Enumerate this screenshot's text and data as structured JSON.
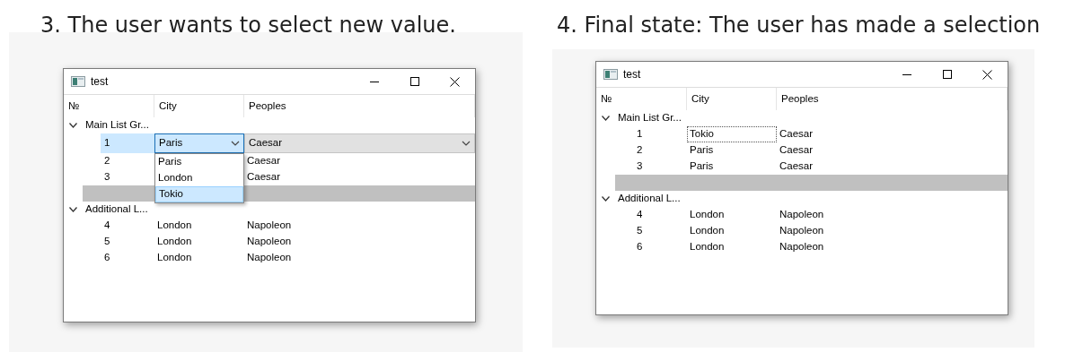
{
  "panels": [
    {
      "caption": "3. The user wants to select new value.",
      "window": {
        "title": "test",
        "columns": [
          "№",
          "City",
          "Peoples"
        ],
        "groups": [
          {
            "name": "Main List Gr...",
            "expanded": true,
            "blank_row": true,
            "rows": [
              {
                "number": "1",
                "city": "Paris",
                "people": "Caesar",
                "editing": true,
                "focused": false,
                "dropdown": [
                  {
                    "label": "Paris",
                    "selected": false
                  },
                  {
                    "label": "London",
                    "selected": false
                  },
                  {
                    "label": "Tokio",
                    "selected": true
                  }
                ]
              },
              {
                "number": "2",
                "people": "Caesar",
                "editing": false,
                "focused": false
              },
              {
                "number": "3",
                "people": "Caesar",
                "editing": false,
                "focused": false
              }
            ]
          },
          {
            "name": "Additional L...",
            "expanded": true,
            "blank_row": false,
            "rows": [
              {
                "number": "4",
                "city": "London",
                "people": "Napoleon",
                "editing": false,
                "focused": false
              },
              {
                "number": "5",
                "city": "London",
                "people": "Napoleon",
                "editing": false,
                "focused": false
              },
              {
                "number": "6",
                "city": "London",
                "people": "Napoleon",
                "editing": false,
                "focused": false
              }
            ]
          }
        ]
      }
    },
    {
      "caption": "4. Final state: The user has made a selection",
      "window": {
        "title": "test",
        "columns": [
          "№",
          "City",
          "Peoples"
        ],
        "groups": [
          {
            "name": "Main List Gr...",
            "expanded": true,
            "blank_row": true,
            "rows": [
              {
                "number": "1",
                "city": "Tokio",
                "people": "Caesar",
                "editing": false,
                "focused": true
              },
              {
                "number": "2",
                "city": "Paris",
                "people": "Caesar",
                "editing": false,
                "focused": false
              },
              {
                "number": "3",
                "city": "Paris",
                "people": "Caesar",
                "editing": false,
                "focused": false
              }
            ]
          },
          {
            "name": "Additional L...",
            "expanded": true,
            "blank_row": false,
            "rows": [
              {
                "number": "4",
                "city": "London",
                "people": "Napoleon",
                "editing": false,
                "focused": false
              },
              {
                "number": "5",
                "city": "London",
                "people": "Napoleon",
                "editing": false,
                "focused": false
              },
              {
                "number": "6",
                "city": "London",
                "people": "Napoleon",
                "editing": false,
                "focused": false
              }
            ]
          }
        ]
      }
    }
  ]
}
